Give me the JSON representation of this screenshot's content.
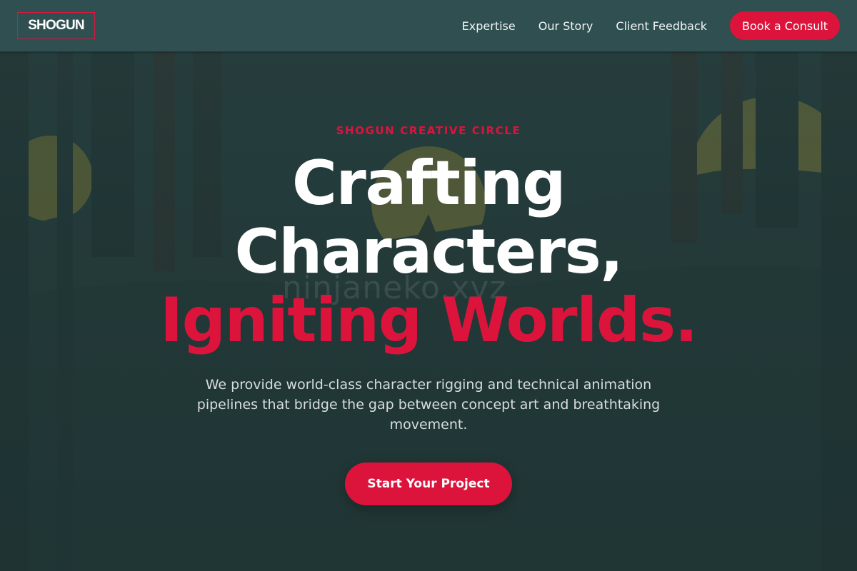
{
  "brand": {
    "logo_text": "SHOGUN",
    "accent_color": "#dc143c"
  },
  "nav": {
    "links": [
      {
        "label": "Expertise"
      },
      {
        "label": "Our Story"
      },
      {
        "label": "Client Feedback"
      }
    ],
    "cta_label": "Book a Consult"
  },
  "hero": {
    "eyebrow": "SHOGUN CREATIVE CIRCLE",
    "headline_line1": "Crafting",
    "headline_line2": "Characters,",
    "headline_line3": "Igniting Worlds.",
    "subtext": "We provide world-class character rigging and technical animation pipelines that bridge the gap between concept art and breathtaking movement.",
    "cta_label": "Start Your Project"
  },
  "background": {
    "watermark": "ninjaneko.xyz"
  }
}
